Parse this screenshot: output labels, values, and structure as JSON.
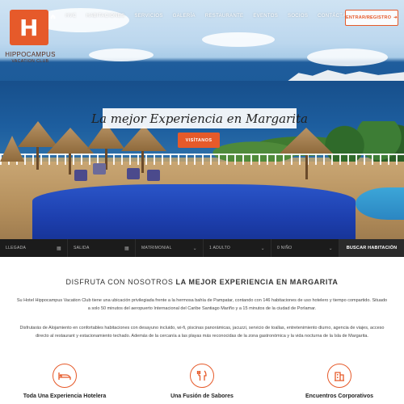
{
  "brand": {
    "name": "HIPPOCAMPUS",
    "sub": "VACATION CLUB"
  },
  "nav": {
    "items": [
      "HVC",
      "HABITACIONES",
      "SERVICIOS",
      "GALERÍA",
      "RESTAURANTE",
      "EVENTOS",
      "SOCIOS",
      "CONTÁCTANOS"
    ],
    "lang": "ES"
  },
  "login": {
    "label": "ENTRAR/REGISTRO"
  },
  "hero": {
    "headline": "La mejor Experiencia en Margarita",
    "cta": "VISÍTANOS"
  },
  "booking": {
    "checkin": "LLEGADA",
    "checkout": "SALIDA",
    "room_type": "MATRIMONIAL",
    "adults": "1 ADULTO",
    "children": "0 NIÑO",
    "search": "BUSCAR HABITACIÓN"
  },
  "intro": {
    "title_prefix": "DISFRUTA CON NOSOTROS ",
    "title_bold": "LA MEJOR EXPERIENCIA EN MARGARITA",
    "p1": "Su Hotel Hippocampus Vacation Club tiene una ubicación privilegiada frente a la hermosa bahía de Pampatar, contando con 146 habitaciones de uso hotelero y tiempo compartido. Situado a solo 50 minutos del aeropuerto Internacional del Caribe Santiago Mariño y a 15 minutos de la ciudad de Porlamar.",
    "p2": "Disfrutarás de Alojamiento en confortables habitaciones con desayuno incluido, wi-fi, piscinas panorámicas, jacuzzi, servicio de toallas, entretenimiento diurno, agencia de viajes, acceso directo al restaurant y estacionamiento techado. Además de la cercanía a las playas más reconocidas de la zona gastronómica y la vida nocturna de la Isla de Margarita."
  },
  "features": [
    {
      "title": "Toda Una Experiencia Hotelera",
      "icon": "bed-icon"
    },
    {
      "title": "Una Fusión de Sabores",
      "icon": "utensils-icon"
    },
    {
      "title": "Encuentros Corporativos",
      "icon": "building-icon"
    }
  ],
  "colors": {
    "accent": "#e65a2a",
    "bar": "#1b1b1b"
  }
}
